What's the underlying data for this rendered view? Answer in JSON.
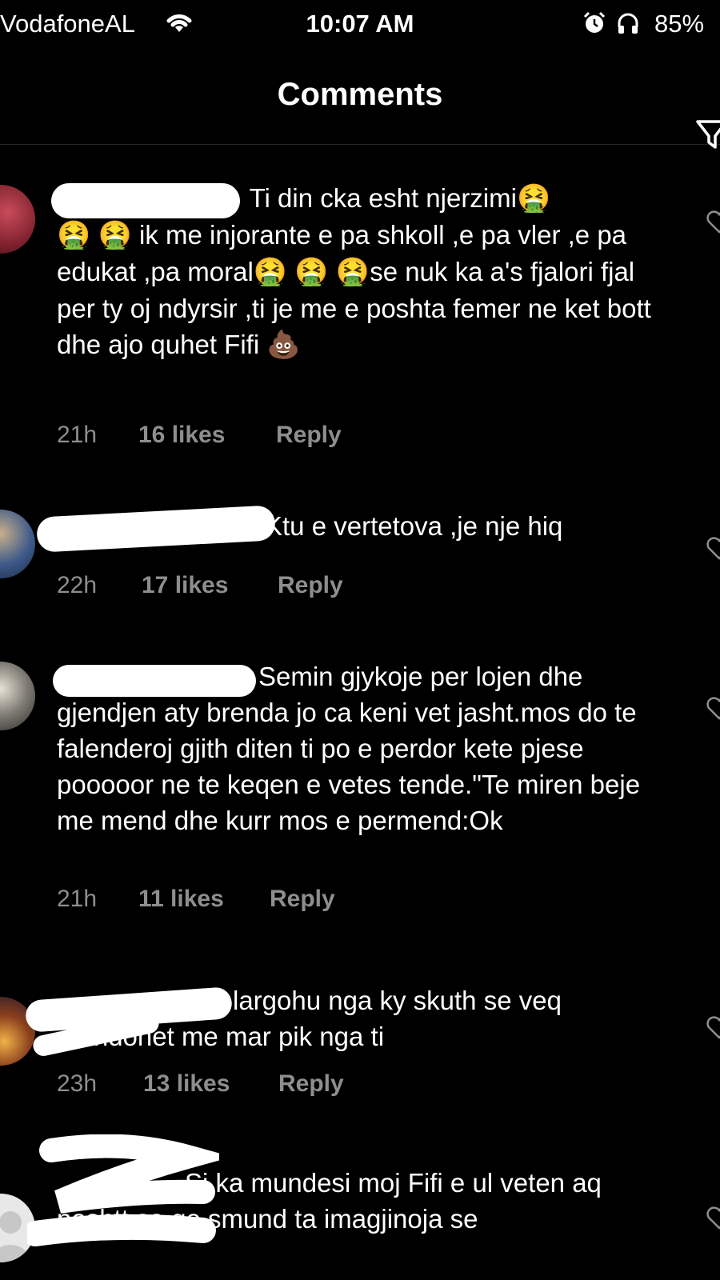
{
  "status_bar": {
    "carrier": "VodafoneAL",
    "time": "10:07 AM",
    "battery": "85%"
  },
  "header": {
    "title": "Comments"
  },
  "comments": [
    {
      "username": "",
      "text_1": " Ti din cka esht njerzimi",
      "text_2": " ik me injorante e pa shkoll ,e pa vler ,e pa edukat ,pa moral",
      "text_3": "se nuk ka a's fjalori fjal per ty oj ndyrsir ,ti je me e poshta femer ne ket bott dhe ajo quhet Fifi ",
      "time": "21h",
      "likes": "16 likes",
      "reply": "Reply",
      "emoji_vomit": "🤮",
      "emoji_poop": "💩"
    },
    {
      "username": "",
      "text": "Ktu e vertetova ,je nje hiq",
      "time": "22h",
      "likes": "17 likes",
      "reply": "Reply"
    },
    {
      "username": "",
      "text": "Semin gjykoje per lojen dhe gjendjen aty brenda jo ca keni vet jasht.mos do te falenderoj gjith diten  ti po e perdor kete pjese pooooor ne te keqen e vetes tende.\"Te miren beje me mend dhe kurr mos e permend:Ok",
      "time": "21h",
      "likes": "11 likes",
      "reply": "Reply"
    },
    {
      "username": "",
      "text": "largohu nga ky skuth se veq mundohet me mar pik nga ti",
      "time": "23h",
      "likes": "13 likes",
      "reply": "Reply"
    },
    {
      "username": "",
      "text": "Si ka mundesi moj Fifi e ul veten aq poshtt sa qe smund ta imagjinoja se"
    }
  ],
  "icons": {
    "wifi": "wifi-icon",
    "alarm": "alarm-icon",
    "headphones": "headphones-icon",
    "filter": "filter-icon",
    "heart": "heart-icon"
  },
  "colors": {
    "background": "#000000",
    "text": "#ffffff",
    "secondary": "#8e8e8e"
  }
}
